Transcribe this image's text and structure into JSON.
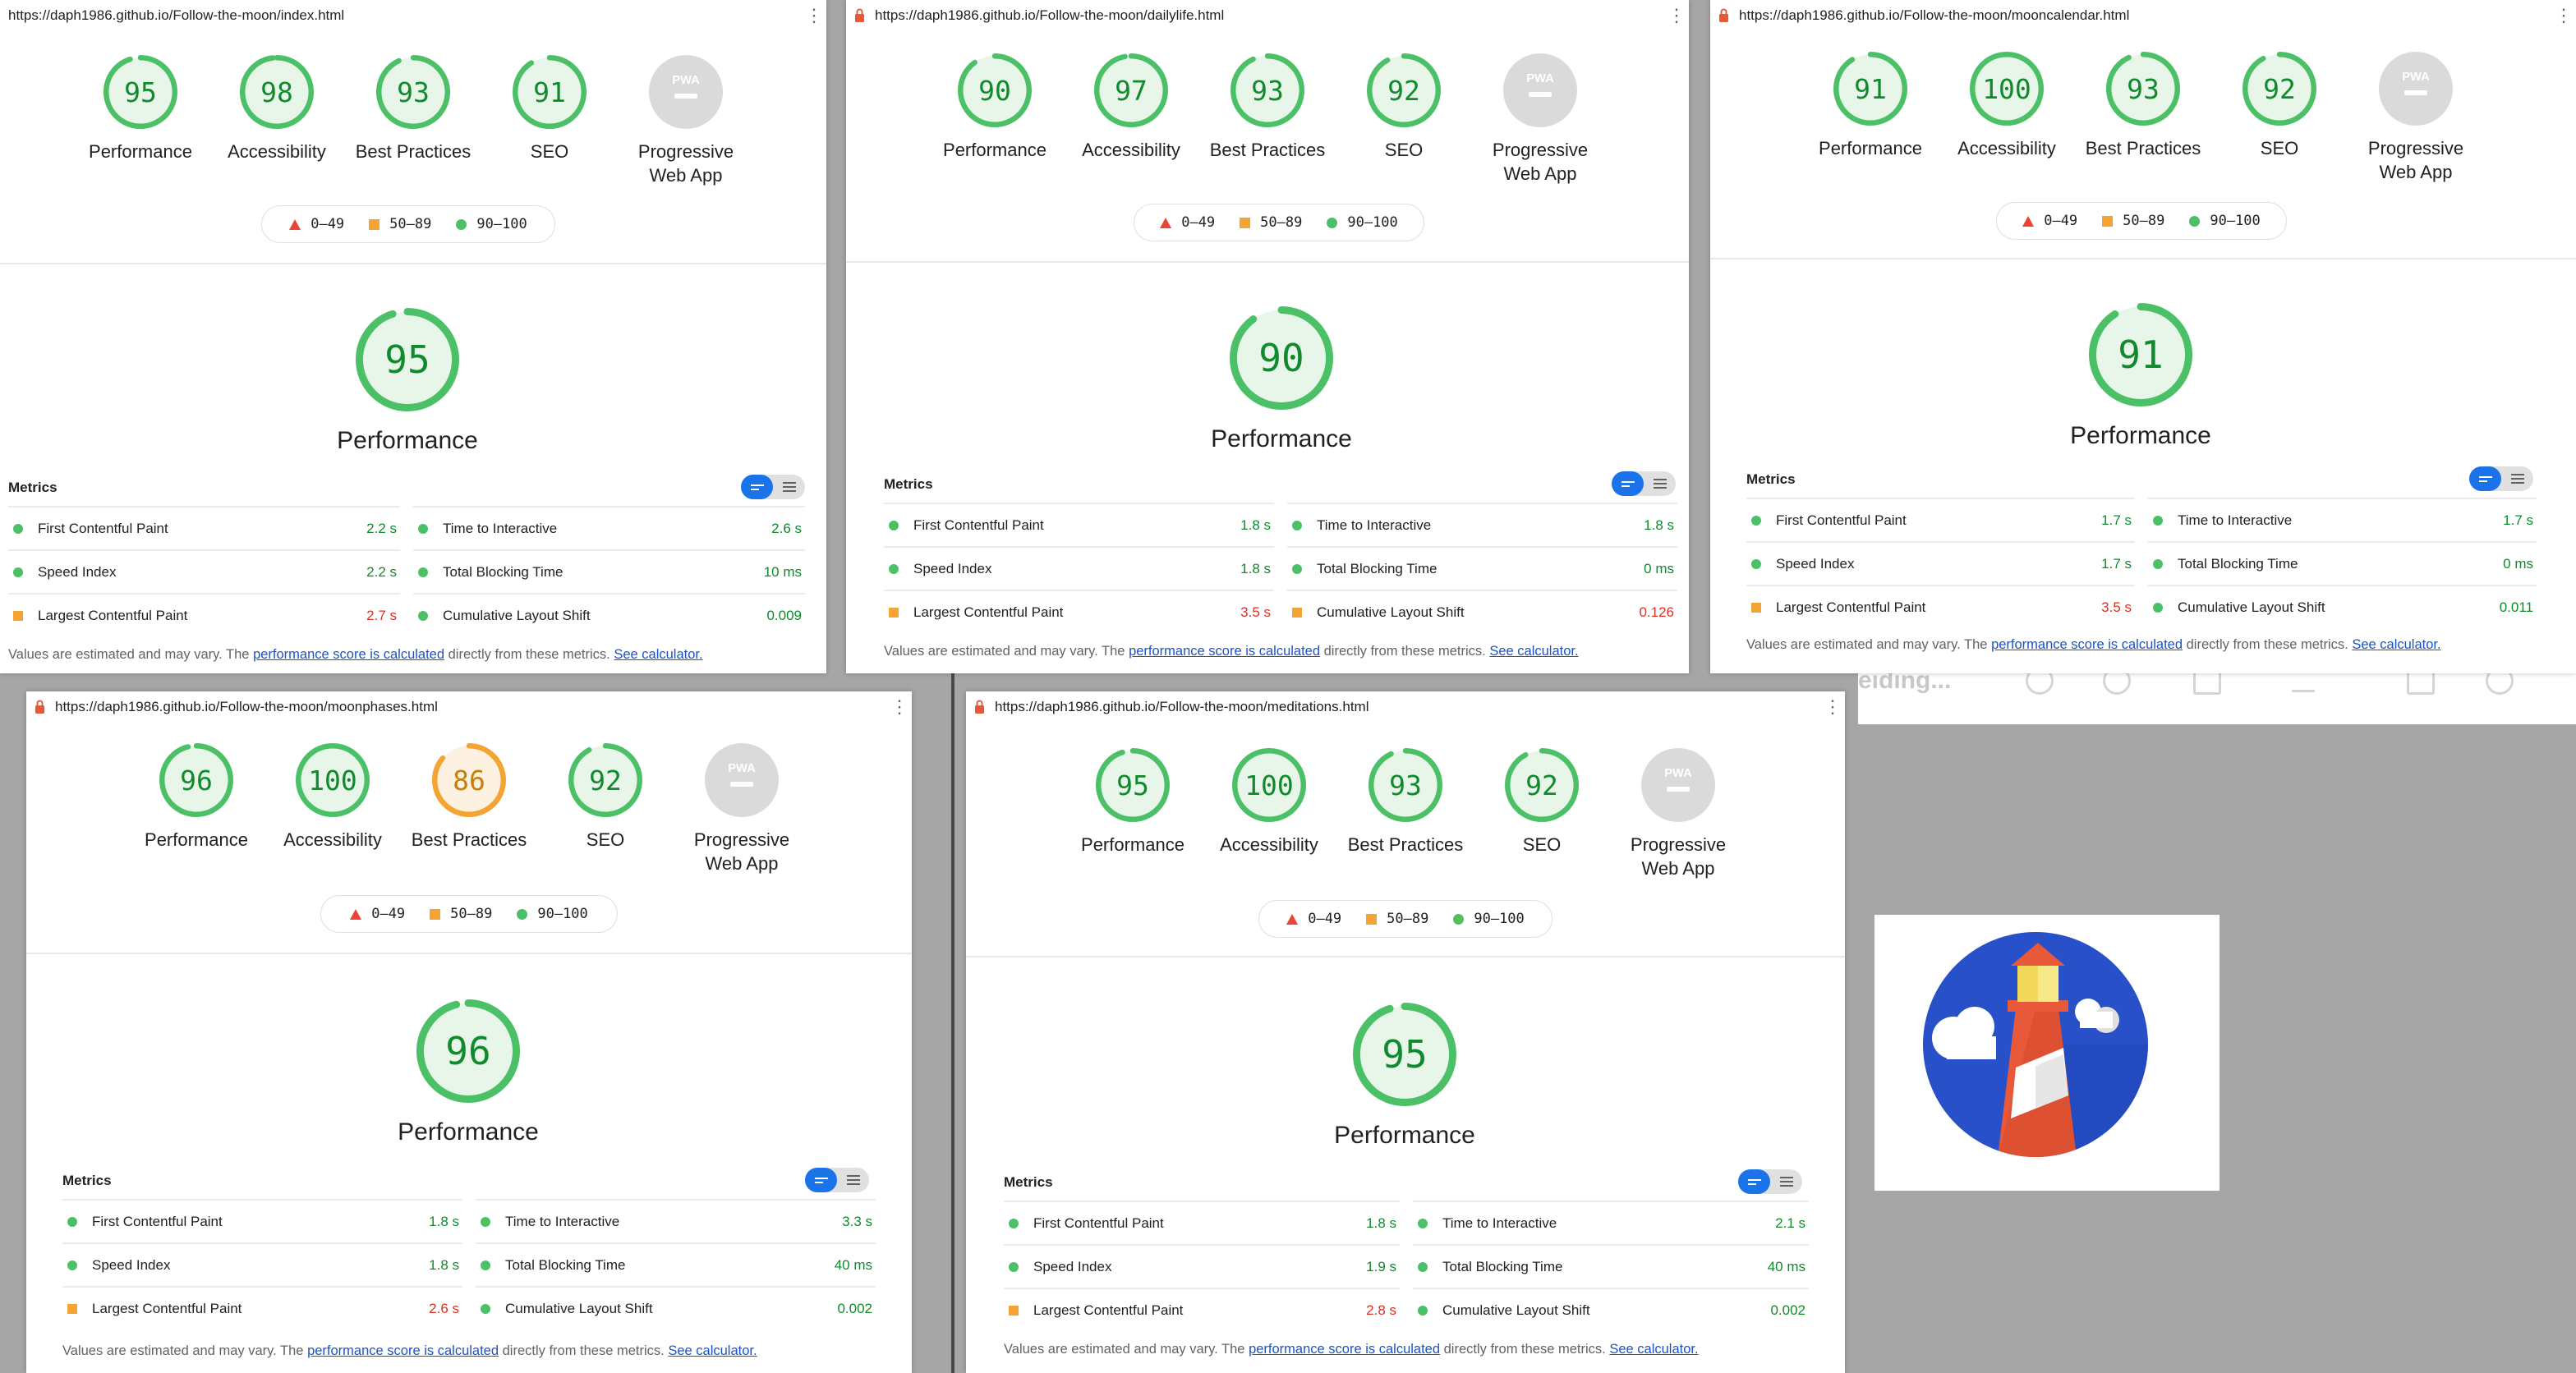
{
  "legend": {
    "low": "0–49",
    "mid": "50–89",
    "high": "90–100"
  },
  "metrics_heading": "Metrics",
  "metric_names": {
    "fcp": "First Contentful Paint",
    "si": "Speed Index",
    "lcp": "Largest Contentful Paint",
    "tti": "Time to Interactive",
    "tbt": "Total Blocking Time",
    "cls": "Cumulative Layout Shift"
  },
  "note": {
    "prefix": "Values are estimated and may vary. The ",
    "link1": "performance score is calculated",
    "middle": " directly from these metrics. ",
    "link2": "See calculator."
  },
  "category_labels": {
    "performance": "Performance",
    "accessibility": "Accessibility",
    "best_practices": "Best Practices",
    "seo": "SEO",
    "pwa_line1": "Progressive",
    "pwa_line2": "Web App"
  },
  "pwa_badge": "PWA",
  "colors": {
    "pass": "#4cc067",
    "average": "#f4a432",
    "fail": "#eb4335",
    "pwa": "#dadada"
  },
  "background_text": "eiding...",
  "reports": [
    {
      "url": "https://daph1986.github.io/Follow-the-moon/index.html",
      "lock": false,
      "scores": {
        "performance": "95",
        "accessibility": "98",
        "best_practices": "93",
        "seo": "91"
      },
      "metrics": {
        "fcp": "2.2 s",
        "si": "2.2 s",
        "lcp": "2.7 s",
        "tti": "2.6 s",
        "tbt": "10 ms",
        "cls": "0.009"
      }
    },
    {
      "url": "https://daph1986.github.io/Follow-the-moon/dailylife.html",
      "lock": true,
      "scores": {
        "performance": "90",
        "accessibility": "97",
        "best_practices": "93",
        "seo": "92"
      },
      "metrics": {
        "fcp": "1.8 s",
        "si": "1.8 s",
        "lcp": "3.5 s",
        "tti": "1.8 s",
        "tbt": "0 ms",
        "cls": "0.126"
      }
    },
    {
      "url": "https://daph1986.github.io/Follow-the-moon/mooncalendar.html",
      "lock": true,
      "scores": {
        "performance": "91",
        "accessibility": "100",
        "best_practices": "93",
        "seo": "92"
      },
      "metrics": {
        "fcp": "1.7 s",
        "si": "1.7 s",
        "lcp": "3.5 s",
        "tti": "1.7 s",
        "tbt": "0 ms",
        "cls": "0.011"
      }
    },
    {
      "url": "https://daph1986.github.io/Follow-the-moon/moonphases.html",
      "lock": true,
      "scores": {
        "performance": "96",
        "accessibility": "100",
        "best_practices": "86",
        "seo": "92"
      },
      "metrics": {
        "fcp": "1.8 s",
        "si": "1.8 s",
        "lcp": "2.6 s",
        "tti": "3.3 s",
        "tbt": "40 ms",
        "cls": "0.002"
      }
    },
    {
      "url": "https://daph1986.github.io/Follow-the-moon/meditations.html",
      "lock": true,
      "scores": {
        "performance": "95",
        "accessibility": "100",
        "best_practices": "93",
        "seo": "92"
      },
      "metrics": {
        "fcp": "1.8 s",
        "si": "1.9 s",
        "lcp": "2.8 s",
        "tti": "2.1 s",
        "tbt": "40 ms",
        "cls": "0.002"
      }
    }
  ]
}
